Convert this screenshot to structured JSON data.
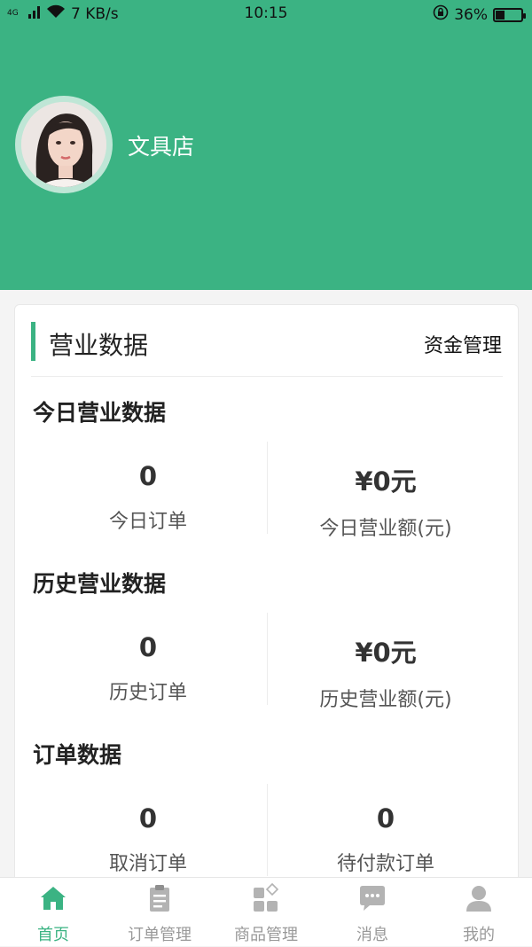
{
  "status_bar": {
    "network": "4G",
    "speed": "7 KB/s",
    "time": "10:15",
    "battery": "36%",
    "battery_level": 0.36
  },
  "profile": {
    "shop_name": "文具店"
  },
  "card": {
    "title": "营业数据",
    "fund_link": "资金管理",
    "sections": [
      {
        "title": "今日营业数据",
        "left": {
          "value": "0",
          "label": "今日订单"
        },
        "right": {
          "value": "¥0元",
          "label": "今日营业额(元)"
        }
      },
      {
        "title": "历史营业数据",
        "left": {
          "value": "0",
          "label": "历史订单"
        },
        "right": {
          "value": "¥0元",
          "label": "历史营业额(元)"
        }
      },
      {
        "title": "订单数据",
        "left": {
          "value": "0",
          "label": "取消订单"
        },
        "right": {
          "value": "0",
          "label": "待付款订单"
        }
      }
    ]
  },
  "tabbar": [
    {
      "label": "首页",
      "icon": "home-icon",
      "active": true
    },
    {
      "label": "订单管理",
      "icon": "clipboard-icon",
      "active": false
    },
    {
      "label": "商品管理",
      "icon": "grid-icon",
      "active": false
    },
    {
      "label": "消息",
      "icon": "chat-icon",
      "active": false
    },
    {
      "label": "我的",
      "icon": "user-icon",
      "active": false
    }
  ],
  "colors": {
    "brand": "#3bb383",
    "inactive": "#b3b3b3"
  }
}
